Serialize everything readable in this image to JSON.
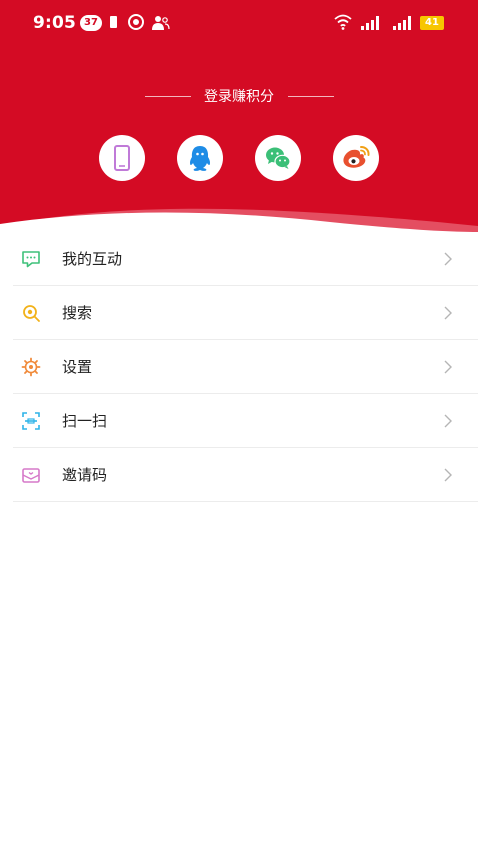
{
  "status_bar": {
    "time": "9:05",
    "notification_count": "37",
    "battery_level": "41"
  },
  "login": {
    "title": "登录赚积分",
    "options": [
      {
        "name": "phone",
        "icon": "phone-icon",
        "color": "#c07ad8"
      },
      {
        "name": "qq",
        "icon": "qq-penguin-icon",
        "color": "#1e8ce6"
      },
      {
        "name": "wechat",
        "icon": "wechat-icon",
        "color": "#3bbf77"
      },
      {
        "name": "weibo",
        "icon": "weibo-icon",
        "color": "#e8502f"
      }
    ]
  },
  "menu": {
    "items": [
      {
        "label": "我的互动",
        "icon": "chat-bubble-icon",
        "color": "#3ec17a"
      },
      {
        "label": "搜索",
        "icon": "search-icon",
        "color": "#f2b21a"
      },
      {
        "label": "设置",
        "icon": "gear-icon",
        "color": "#f08a3a"
      },
      {
        "label": "扫一扫",
        "icon": "scan-icon",
        "color": "#2fb4e8"
      },
      {
        "label": "邀请码",
        "icon": "invitation-envelope-icon",
        "color": "#d679c9"
      }
    ]
  },
  "colors": {
    "header_red": "#d40b24",
    "divider": "#ececec",
    "chevron": "#b5b5b5"
  }
}
